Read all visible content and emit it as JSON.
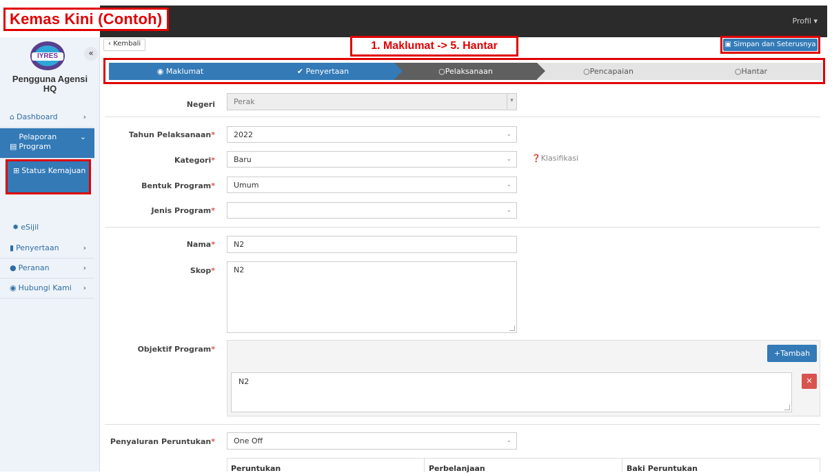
{
  "annotations": {
    "title": "Kemas Kini (Contoh)",
    "steps_note": "1. Maklumat -> 5. Hantar"
  },
  "topbar": {
    "profile": "Profil ▾"
  },
  "sidebar": {
    "collapse": "«",
    "logo_text": "IYRES",
    "user_name_line1": "Pengguna Agensi",
    "user_name_line2": "HQ",
    "items": [
      {
        "label": "Dashboard"
      },
      {
        "label": "Pelaporan Program"
      },
      {
        "label": "Status Kemajuan"
      },
      {
        "label": "eSijil"
      },
      {
        "label": "Penyertaan"
      },
      {
        "label": "Peranan"
      },
      {
        "label": "Hubungi Kami"
      }
    ]
  },
  "toolbar": {
    "back_label": "Kembali",
    "save_label": "Simpan dan Seterusnya"
  },
  "steps": [
    {
      "label": "Maklumat",
      "state": "done"
    },
    {
      "label": "Penyertaan",
      "state": "done"
    },
    {
      "label": "Pelaksanaan",
      "state": "current"
    },
    {
      "label": "Pencapaian",
      "state": "todo"
    },
    {
      "label": "Hantar",
      "state": "todo"
    }
  ],
  "form": {
    "negeri": {
      "label": "Negeri",
      "value": "Perak"
    },
    "tahun": {
      "label": "Tahun Pelaksanaan",
      "value": "2022"
    },
    "kategori": {
      "label": "Kategori",
      "value": "Baru",
      "hint": "Klasifikasi"
    },
    "bentuk": {
      "label": "Bentuk Program",
      "value": "Umum"
    },
    "jenis": {
      "label": "Jenis Program",
      "value": ""
    },
    "nama": {
      "label": "Nama",
      "value": "N2"
    },
    "skop": {
      "label": "Skop",
      "value": "N2"
    },
    "objektif": {
      "label": "Objektif Program",
      "add_label": "Tambah",
      "items": [
        "N2"
      ]
    },
    "penyaluran": {
      "label": "Penyaluran Peruntukan",
      "value": "One Off"
    },
    "table_headers": [
      "Peruntukan",
      "Perbelanjaan",
      "Baki Peruntukan"
    ]
  },
  "colors": {
    "primary": "#337ab7",
    "current_step": "#5f5f5f",
    "annotation": "#e00000",
    "danger": "#d9534f",
    "topbar": "#2b2b2b"
  }
}
